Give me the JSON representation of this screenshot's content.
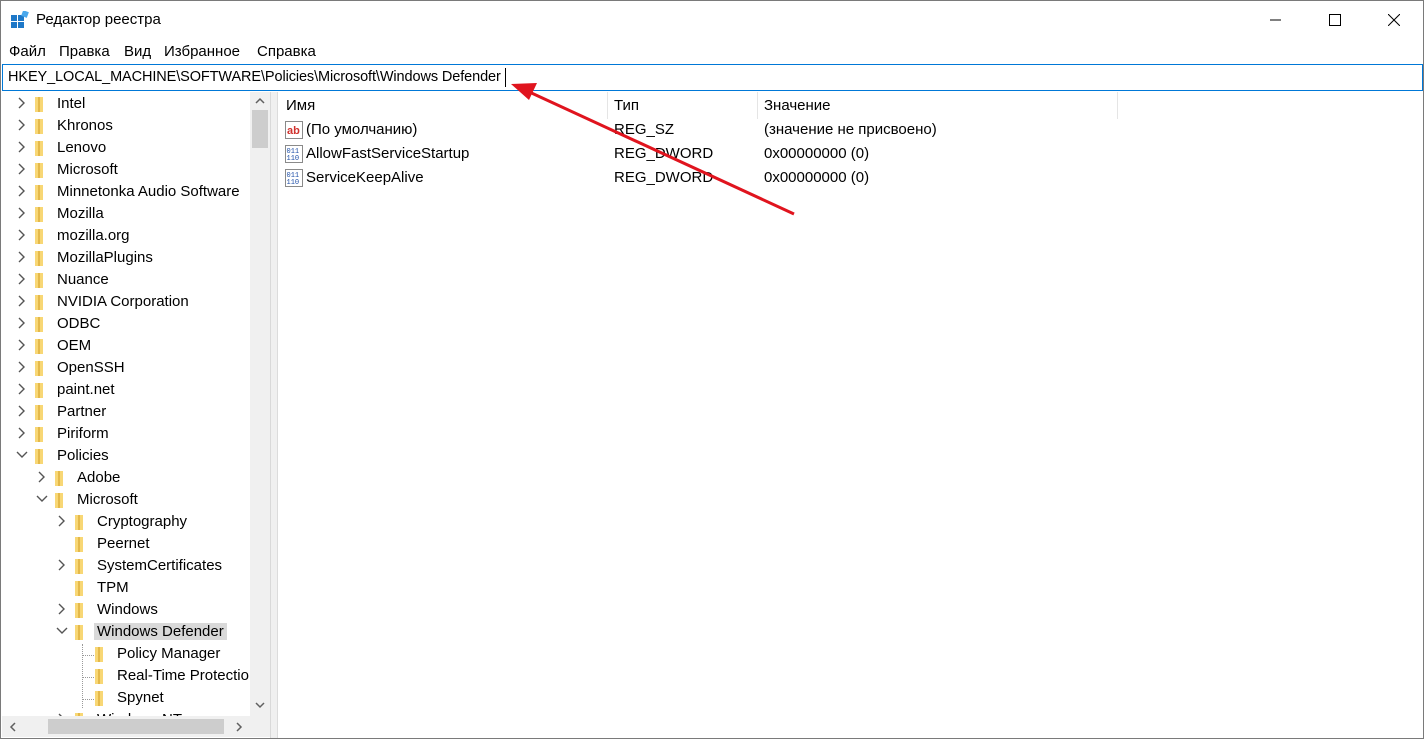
{
  "window": {
    "title": "Редактор реестра"
  },
  "menu": [
    "Файл",
    "Правка",
    "Вид",
    "Избранное",
    "Справка"
  ],
  "address": {
    "path": "HKEY_LOCAL_MACHINE\\SOFTWARE\\Policies\\Microsoft\\Windows Defender"
  },
  "tree": {
    "items": [
      {
        "label": "Intel",
        "state": "collapsed"
      },
      {
        "label": "Khronos",
        "state": "collapsed"
      },
      {
        "label": "Lenovo",
        "state": "collapsed"
      },
      {
        "label": "Microsoft",
        "state": "collapsed"
      },
      {
        "label": "Minnetonka Audio Software",
        "state": "collapsed"
      },
      {
        "label": "Mozilla",
        "state": "collapsed"
      },
      {
        "label": "mozilla.org",
        "state": "collapsed"
      },
      {
        "label": "MozillaPlugins",
        "state": "collapsed"
      },
      {
        "label": "Nuance",
        "state": "collapsed"
      },
      {
        "label": "NVIDIA Corporation",
        "state": "collapsed"
      },
      {
        "label": "ODBC",
        "state": "collapsed"
      },
      {
        "label": "OEM",
        "state": "collapsed"
      },
      {
        "label": "OpenSSH",
        "state": "collapsed"
      },
      {
        "label": "paint.net",
        "state": "collapsed"
      },
      {
        "label": "Partner",
        "state": "collapsed"
      },
      {
        "label": "Piriform",
        "state": "collapsed"
      },
      {
        "label": "Policies",
        "state": "expanded"
      },
      {
        "label": "Adobe",
        "state": "collapsed"
      },
      {
        "label": "Microsoft",
        "state": "expanded"
      },
      {
        "label": "Cryptography",
        "state": "collapsed"
      },
      {
        "label": "Peernet",
        "state": "leaf"
      },
      {
        "label": "SystemCertificates",
        "state": "collapsed"
      },
      {
        "label": "TPM",
        "state": "leaf"
      },
      {
        "label": "Windows",
        "state": "collapsed"
      },
      {
        "label": "Windows Defender",
        "state": "expanded",
        "selected": true
      },
      {
        "label": "Policy Manager",
        "state": "leaf"
      },
      {
        "label": "Real-Time Protectio",
        "state": "leaf"
      },
      {
        "label": "Spynet",
        "state": "leaf"
      },
      {
        "label": "Windows NT",
        "state": "collapsed"
      }
    ]
  },
  "columns": {
    "name": "Имя",
    "type": "Тип",
    "value": "Значение"
  },
  "values": [
    {
      "icon": "string-value-icon",
      "name": "(По умолчанию)",
      "type": "REG_SZ",
      "data": "(значение не присвоено)"
    },
    {
      "icon": "binary-value-icon",
      "name": "AllowFastServiceStartup",
      "type": "REG_DWORD",
      "data": "0x00000000 (0)"
    },
    {
      "icon": "binary-value-icon",
      "name": "ServiceKeepAlive",
      "type": "REG_DWORD",
      "data": "0x00000000 (0)"
    }
  ],
  "colors": {
    "accent": "#0078d7",
    "folder": "#f8d775",
    "annotation_arrow": "#e0141e"
  }
}
